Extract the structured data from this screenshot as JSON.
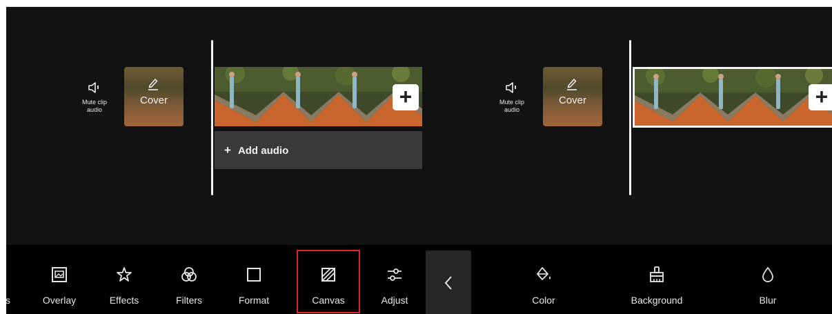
{
  "left_panel": {
    "mute_label": "Mute clip\naudio",
    "cover_label": "Cover",
    "add_audio_label": "Add audio",
    "add_clip_symbol": "+",
    "add_audio_symbol": "+"
  },
  "right_panel": {
    "mute_label": "Mute clip\naudio",
    "cover_label": "Cover",
    "add_clip_symbol": "+"
  },
  "toolbar": {
    "partial_label": "rs",
    "items": [
      {
        "label": "Overlay",
        "icon": "overlay-icon"
      },
      {
        "label": "Effects",
        "icon": "effects-icon"
      },
      {
        "label": "Filters",
        "icon": "filters-icon"
      },
      {
        "label": "Format",
        "icon": "format-icon"
      },
      {
        "label": "Canvas",
        "icon": "canvas-icon"
      },
      {
        "label": "Adjust",
        "icon": "adjust-icon"
      }
    ],
    "back_icon": "chevron-left-icon",
    "canvas_options": [
      {
        "label": "Color",
        "icon": "paint-bucket-icon"
      },
      {
        "label": "Background",
        "icon": "brush-icon"
      },
      {
        "label": "Blur",
        "icon": "droplet-icon"
      }
    ],
    "selected": "Canvas",
    "highlight_color": "#e0252b"
  }
}
